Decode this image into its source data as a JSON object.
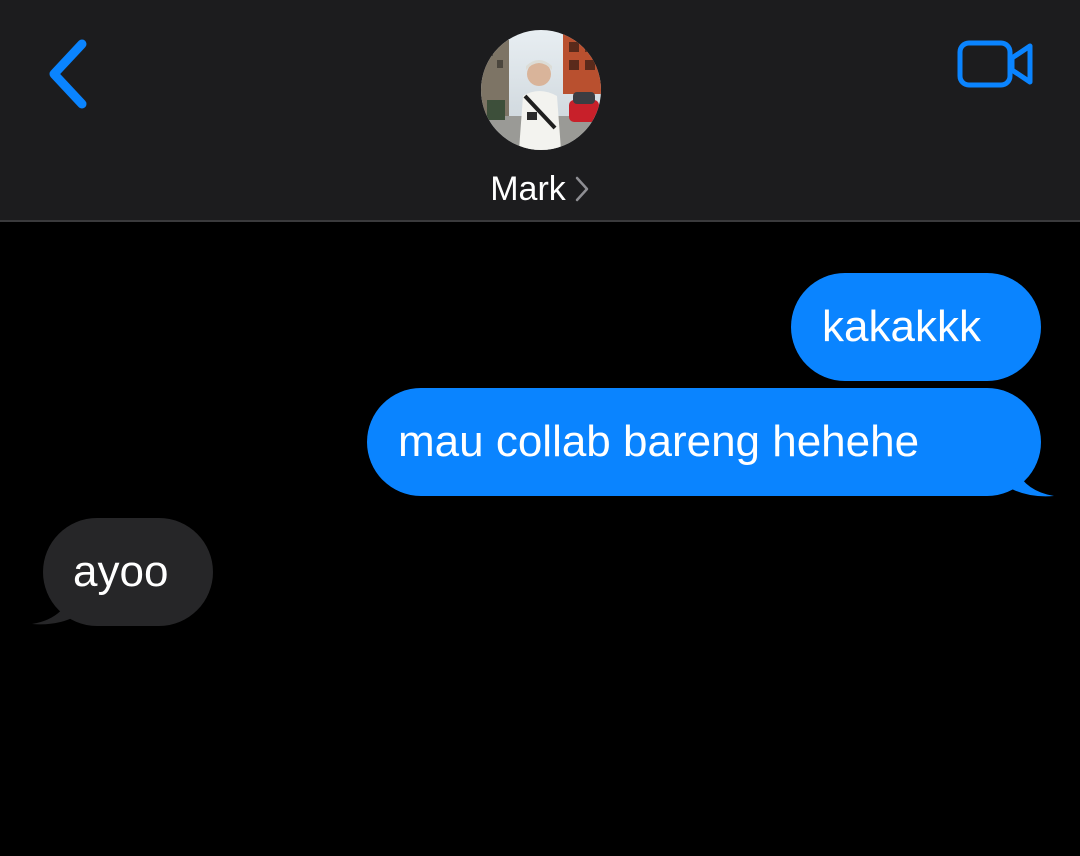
{
  "header": {
    "contact_name": "Mark",
    "accent_color": "#0a84ff",
    "icons": {
      "back": "chevron-left-icon",
      "video": "video-camera-icon",
      "detail": "chevron-right-icon"
    }
  },
  "messages": [
    {
      "direction": "outgoing",
      "text": "kakakkk"
    },
    {
      "direction": "outgoing",
      "text": "mau collab bareng hehehe"
    },
    {
      "direction": "incoming",
      "text": "ayoo"
    }
  ],
  "colors": {
    "header_bg": "#1c1c1e",
    "chat_bg": "#000000",
    "outgoing_bubble": "#0a84ff",
    "incoming_bubble": "#262628"
  }
}
